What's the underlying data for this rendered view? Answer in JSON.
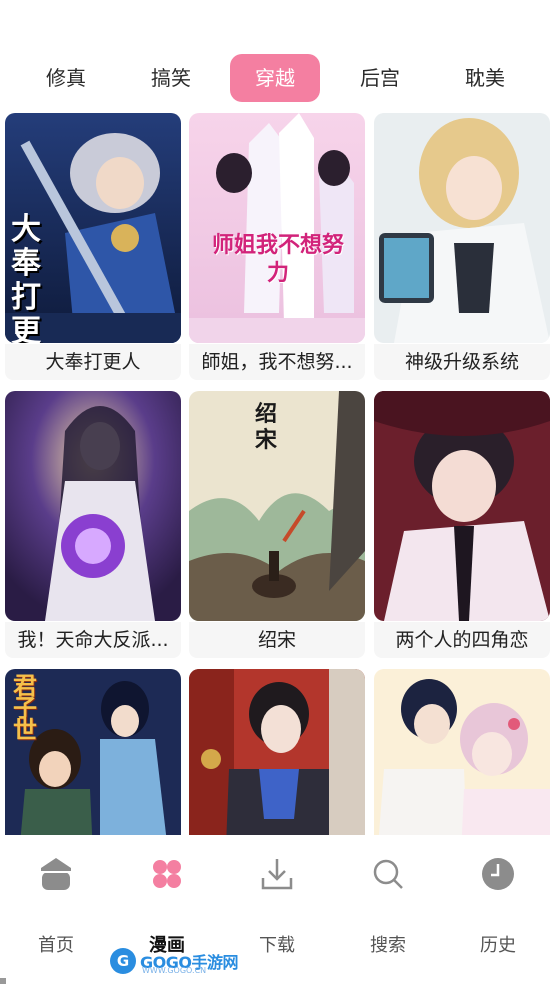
{
  "tabs": [
    {
      "label": "修真",
      "active": false
    },
    {
      "label": "搞笑",
      "active": false
    },
    {
      "label": "穿越",
      "active": true
    },
    {
      "label": "后宫",
      "active": false
    },
    {
      "label": "耽美",
      "active": false
    }
  ],
  "comics": [
    {
      "title": "大奉打更人",
      "cover_text": "大奉打更人"
    },
    {
      "title": "師姐，我不想努...",
      "cover_text": "师姐我不想努力"
    },
    {
      "title": "神级升级系统"
    },
    {
      "title": "我！天命大反派..."
    },
    {
      "title": "绍宋",
      "cover_text": "绍宋"
    },
    {
      "title": "两个人的四角恋"
    },
    {
      "title": "",
      "cover_text": "君子世"
    },
    {
      "title": ""
    },
    {
      "title": ""
    }
  ],
  "nav": [
    {
      "label": "首页",
      "icon": "home-icon",
      "active": false
    },
    {
      "label": "漫画",
      "icon": "comic-grid-icon",
      "active": true
    },
    {
      "label": "下载",
      "icon": "download-icon",
      "active": false
    },
    {
      "label": "搜索",
      "icon": "search-icon",
      "active": false
    },
    {
      "label": "历史",
      "icon": "history-clock-icon",
      "active": false
    }
  ],
  "watermark": {
    "logo_letter": "G",
    "text": "GOGO手游网",
    "sub": "WWW.GOGO.CN"
  },
  "colors": {
    "accent": "#f47fa1",
    "nav_active": "#f47fa1",
    "nav_inactive": "#8a8a8a"
  }
}
